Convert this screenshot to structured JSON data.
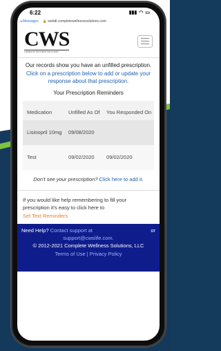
{
  "status_bar": {
    "time": "6:22",
    "back_label": "◂ Messages",
    "signal": "▮▮▮",
    "wifi": "◠",
    "battery": "▭"
  },
  "browser": {
    "url": "🔒 webdl.completewellnesssolutions.com"
  },
  "header": {
    "logo_text": "CWS",
    "logo_tagline": "COMPLETE WELLNESS SOLUTIONS"
  },
  "main": {
    "notice": "Our records show you have an unfilled prescription.",
    "link_message": "Click on a prescription below to add or update your response about that prescription.",
    "section_title": "Your Prescription Reminders",
    "table": {
      "headers": [
        "Medication",
        "Unfilled As Of",
        "You Responded On"
      ],
      "rows": [
        [
          "Lisinopril 10mg",
          "09/08/2020",
          ""
        ],
        [
          "Test",
          "09/02/2020",
          "09/02/2020"
        ]
      ]
    },
    "dont_see_question": "Don't see your prescription?",
    "dont_see_link": "Click here to add it.",
    "help_text": "If you would like help remembering to fill your prescription it's easy to click here to",
    "set_reminders_link": "Set Text Reminders"
  },
  "footer": {
    "need_help": "Need Help?",
    "contact": "Contact support at",
    "or": "or",
    "email": "support@cwslife.com.",
    "copyright": "© 2012-2021 Complete Wellness Solutions, LLC",
    "terms": "Terms of Use",
    "separator": " | ",
    "privacy": "Privacy Policy"
  }
}
